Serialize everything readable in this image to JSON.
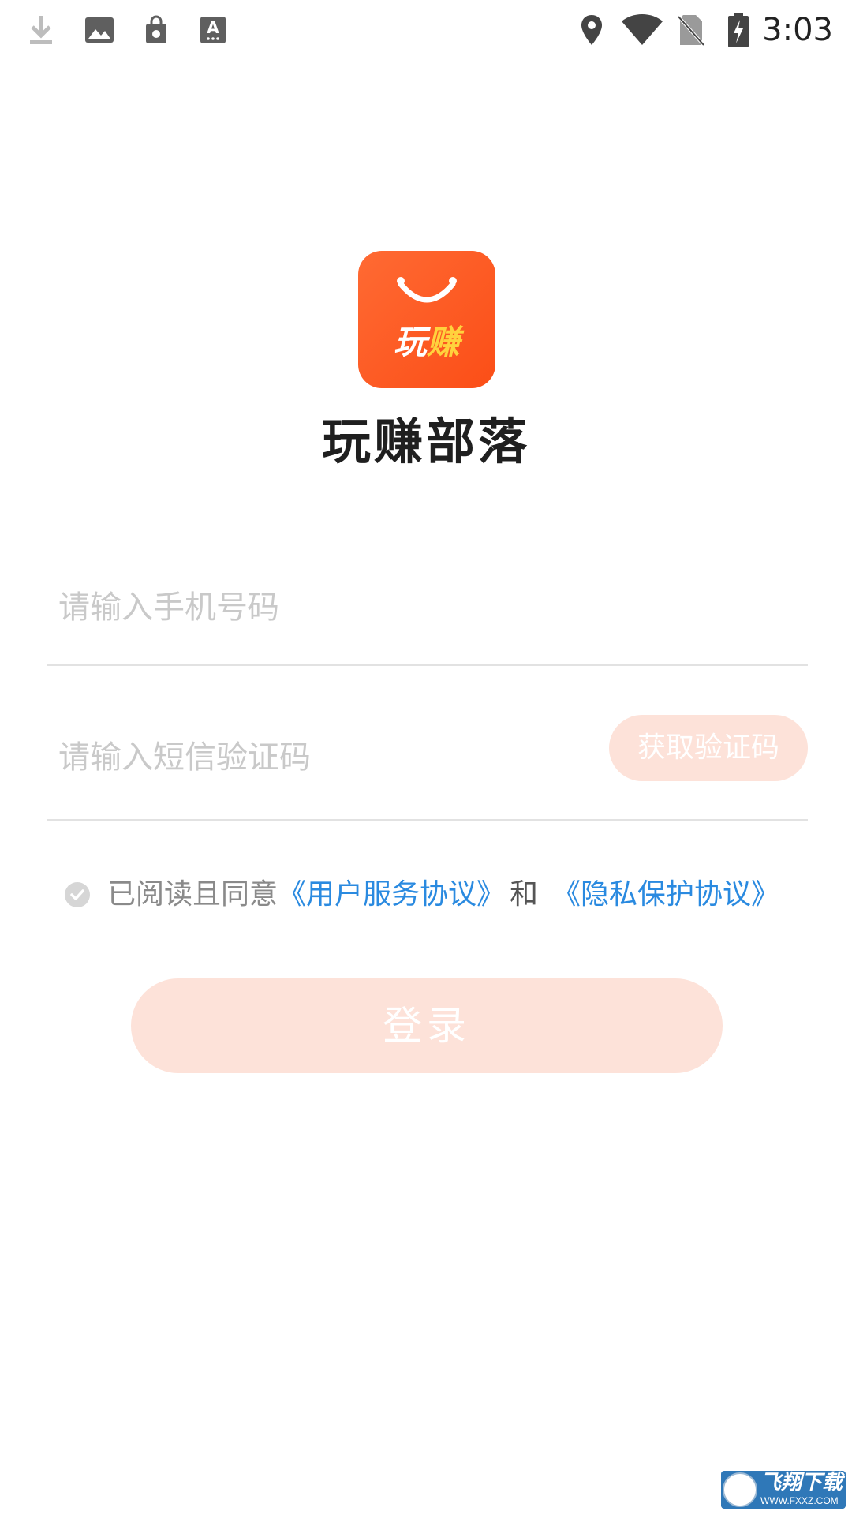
{
  "status_bar": {
    "time": "3:03",
    "left_icons": [
      "download-icon",
      "image-icon",
      "shopping-bag-icon",
      "keyboard-a-icon"
    ],
    "right_icons": [
      "location-icon",
      "wifi-icon",
      "no-sim-icon",
      "battery-charging-icon"
    ]
  },
  "logo": {
    "text_part1": "玩",
    "text_part2": "赚",
    "brand_color": "#fb5a22",
    "accent_color": "#ffd23d"
  },
  "app_name": "玩赚部落",
  "form": {
    "phone_placeholder": "请输入手机号码",
    "code_placeholder": "请输入短信验证码",
    "get_code_label": "获取验证码"
  },
  "agreement": {
    "prefix": "已阅读且同意",
    "user_agreement": "《用户服务协议》",
    "and": "和",
    "privacy_policy": "《隐私保护协议》",
    "link_color": "#2a8ae0"
  },
  "login_label": "登录",
  "watermark": {
    "title": "飞翔下载",
    "url": "WWW.FXXZ.COM"
  }
}
